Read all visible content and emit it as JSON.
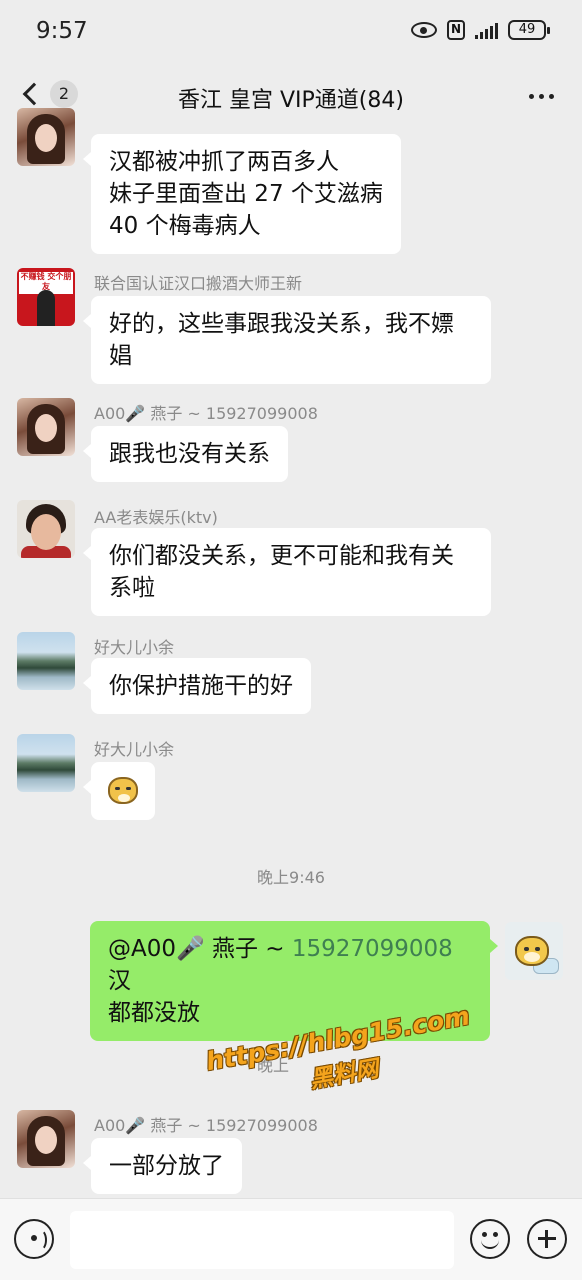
{
  "status_bar": {
    "time": "9:57",
    "battery": "49"
  },
  "header": {
    "unread_count": "2",
    "title": "香江 皇宫 VIP通道(84)"
  },
  "messages": [
    {
      "lines": [
        "汉都被冲抓了两百多人",
        "妹子里面查出 27 个艾滋病",
        "40 个梅毒病人"
      ]
    },
    {
      "sender": "联合国认证汉口搬酒大师王新",
      "avatar_text": "不赚钱 交个朋友",
      "lines": [
        "好的，这些事跟我没关系，我不嫖",
        "娼"
      ]
    },
    {
      "sender": "A00🎤 燕子 ~ 15927099008",
      "lines": [
        "跟我也没有关系"
      ]
    },
    {
      "sender": "AA老表娱乐(ktv)",
      "lines": [
        "你们都没关系，更不可能和我有关",
        "系啦"
      ]
    },
    {
      "sender": "好大儿小余",
      "lines": [
        "你保护措施干的好"
      ]
    },
    {
      "sender": "好大儿小余",
      "sticker": "doge-emoji"
    },
    {
      "outgoing": true,
      "mention": "@A00🎤 燕子 ~ ",
      "number": "15927099008",
      "tail": " 汉",
      "line2": "都都没放"
    },
    {
      "sender": "A00🎤 燕子 ~ 15927099008",
      "lines": [
        "一部分放了"
      ]
    }
  ],
  "time_separators": [
    "晚上9:46",
    "晚上"
  ],
  "watermark": {
    "url": "https://hlbg15.com",
    "name": "黑料网"
  },
  "input_bar": {
    "placeholder": ""
  },
  "colors": {
    "background": "#ededed",
    "outgoing_bubble": "#95ec69",
    "incoming_bubble": "#ffffff",
    "phone_link": "#3f7f51"
  }
}
